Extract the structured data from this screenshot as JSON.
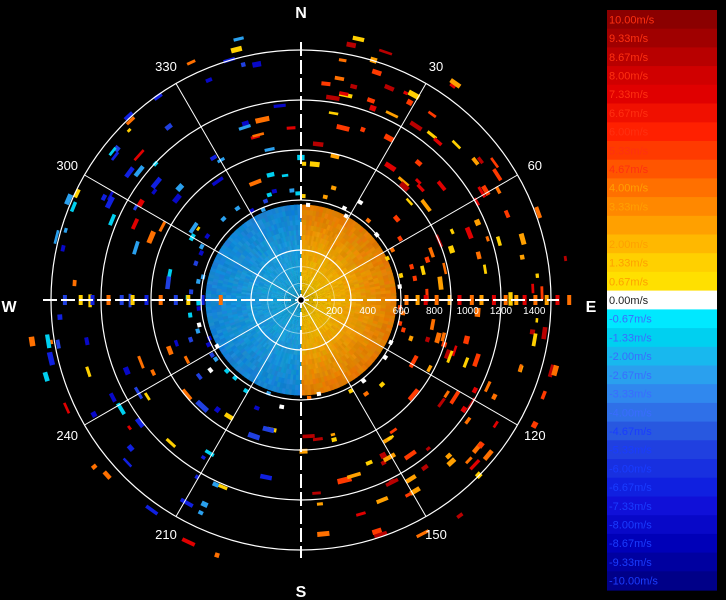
{
  "chart_data": {
    "type": "polar-ppi-velocity",
    "compass": {
      "north": "N",
      "south": "S",
      "east": "E",
      "west": "W"
    },
    "angle_labels": [
      "30",
      "60",
      "120",
      "150",
      "210",
      "240",
      "300",
      "330"
    ],
    "angle_values": [
      30,
      60,
      120,
      150,
      210,
      240,
      300,
      330
    ],
    "range_max": 1500,
    "range_rings": [
      300,
      600,
      900,
      1200,
      1500
    ],
    "range_tick_labels": [
      "200",
      "400",
      "600",
      "800",
      "1000",
      "1200",
      "1400"
    ],
    "range_tick_values": [
      200,
      400,
      600,
      800,
      1000,
      1200,
      1400
    ],
    "core_radius": 560,
    "colorbar": {
      "labels": [
        "10.00m/s",
        "9.33m/s",
        "8.67m/s",
        "8.00m/s",
        "7.33m/s",
        "6.67m/s",
        "6.00m/s",
        "5.33m/s",
        "4.67m/s",
        "4.00m/s",
        "3.33m/s",
        "2.67m/s",
        "2.00m/s",
        "1.33m/s",
        "0.67m/s",
        "0.00m/s",
        "-0.67m/s",
        "-1.33m/s",
        "-2.00m/s",
        "-2.67m/s",
        "-3.33m/s",
        "-4.00m/s",
        "-4.67m/s",
        "-5.33m/s",
        "-6.00m/s",
        "-6.67m/s",
        "-7.33m/s",
        "-8.00m/s",
        "-8.67m/s",
        "-9.33m/s",
        "-10.00m/s"
      ],
      "colors": [
        "#8b0000",
        "#a00000",
        "#b80000",
        "#d00000",
        "#e00000",
        "#f01000",
        "#ff2000",
        "#ff3a00",
        "#ff5500",
        "#ff7000",
        "#ff8800",
        "#ffa000",
        "#ffb800",
        "#ffd000",
        "#ffe000",
        "#ffffff",
        "#00e8ff",
        "#00d0f0",
        "#18b8ee",
        "#2aa0ee",
        "#3088ee",
        "#2f70e8",
        "#2858e0",
        "#2040e0",
        "#1830e0",
        "#1020e0",
        "#1010d8",
        "#0808c8",
        "#0000b8",
        "#0000a0",
        "#000088"
      ]
    }
  }
}
